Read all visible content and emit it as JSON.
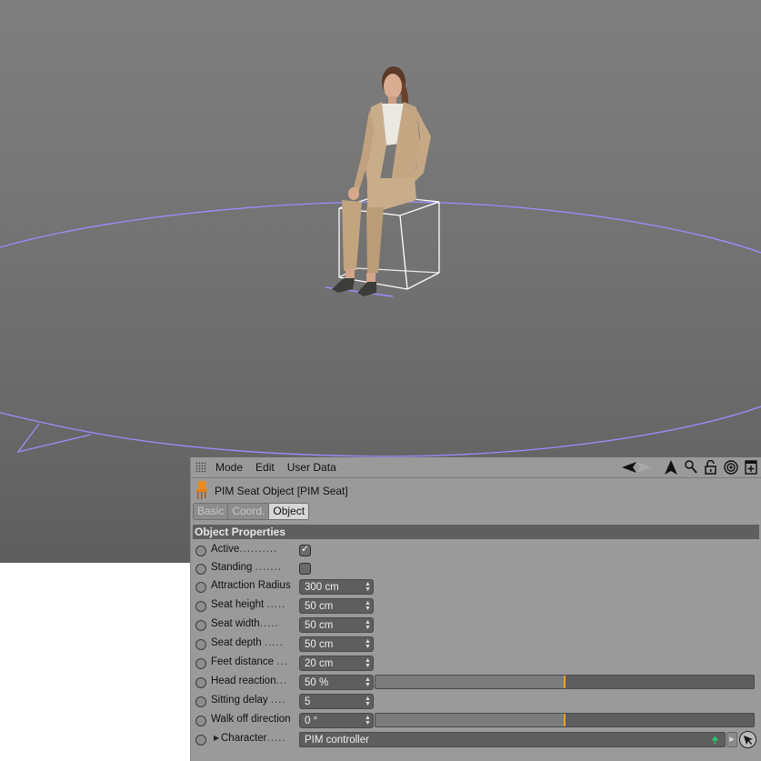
{
  "viewport": {
    "background_top": "#7f7f7f",
    "background_bottom": "#5e5e5e",
    "radius_circle_color": "#9f8cff",
    "seat_box_color": "#ffffff",
    "character_description": "seated woman in beige suit"
  },
  "attribute_manager": {
    "menu": [
      "Mode",
      "Edit",
      "User Data"
    ],
    "tool_icons": [
      "back-arrow-icon",
      "up-arrow-icon",
      "search-icon",
      "lock-icon",
      "target-icon",
      "new-panel-icon"
    ],
    "object_title": "PIM Seat Object [PIM Seat]",
    "tabs": [
      {
        "label": "Basic",
        "active": false
      },
      {
        "label": "Coord.",
        "active": false
      },
      {
        "label": "Object",
        "active": true
      }
    ],
    "section_title": "Object Properties",
    "properties": {
      "active": {
        "label": "Active",
        "dots": "..........",
        "checked": true
      },
      "standing": {
        "label": "Standing",
        "dots": ".......",
        "checked": false
      },
      "attraction_radius": {
        "label": "Attraction Radius",
        "value": "300 cm"
      },
      "seat_height": {
        "label": "Seat height",
        "dots": ".....",
        "value": "50 cm"
      },
      "seat_width": {
        "label": "Seat width",
        "dots": ".....",
        "value": "50 cm"
      },
      "seat_depth": {
        "label": "Seat depth",
        "dots": ".....",
        "value": "50 cm"
      },
      "feet_distance": {
        "label": "Feet distance",
        "dots": "...",
        "value": "20 cm"
      },
      "head_reaction": {
        "label": "Head reaction",
        "dots": "...",
        "value": "50 %",
        "slider_percent": 50
      },
      "sitting_delay": {
        "label": "Sitting delay",
        "dots": "....",
        "value": "5"
      },
      "walk_off_direction": {
        "label": "Walk off direction",
        "value": "0 °",
        "slider_percent": 50
      },
      "character": {
        "label": "Character",
        "dots": ".....",
        "value": "PIM controller"
      }
    },
    "accent_color": "#f0a020"
  }
}
